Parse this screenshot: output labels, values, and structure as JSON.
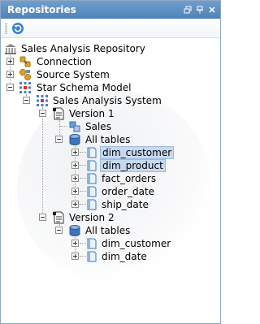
{
  "panel": {
    "title": "Repositories",
    "title_buttons": [
      "restore-icon",
      "pin-icon",
      "close-icon"
    ],
    "accent": "#5a8bc0"
  },
  "toolbar": {
    "refresh_icon": "refresh-icon"
  },
  "tree": {
    "root": "Sales Analysis Repository",
    "connection": "Connection",
    "source_system": "Source System",
    "star_schema_model": "Star Schema Model",
    "sales_analysis_system": "Sales Analysis System",
    "version1": {
      "label": "Version 1",
      "sales": "Sales",
      "all_tables": "All tables",
      "tables": [
        "dim_customer",
        "dim_product",
        "fact_orders",
        "order_date",
        "ship_date"
      ],
      "selected": [
        "dim_customer",
        "dim_product"
      ]
    },
    "version2": {
      "label": "Version 2",
      "all_tables": "All tables",
      "tables": [
        "dim_customer",
        "dim_date"
      ]
    }
  }
}
